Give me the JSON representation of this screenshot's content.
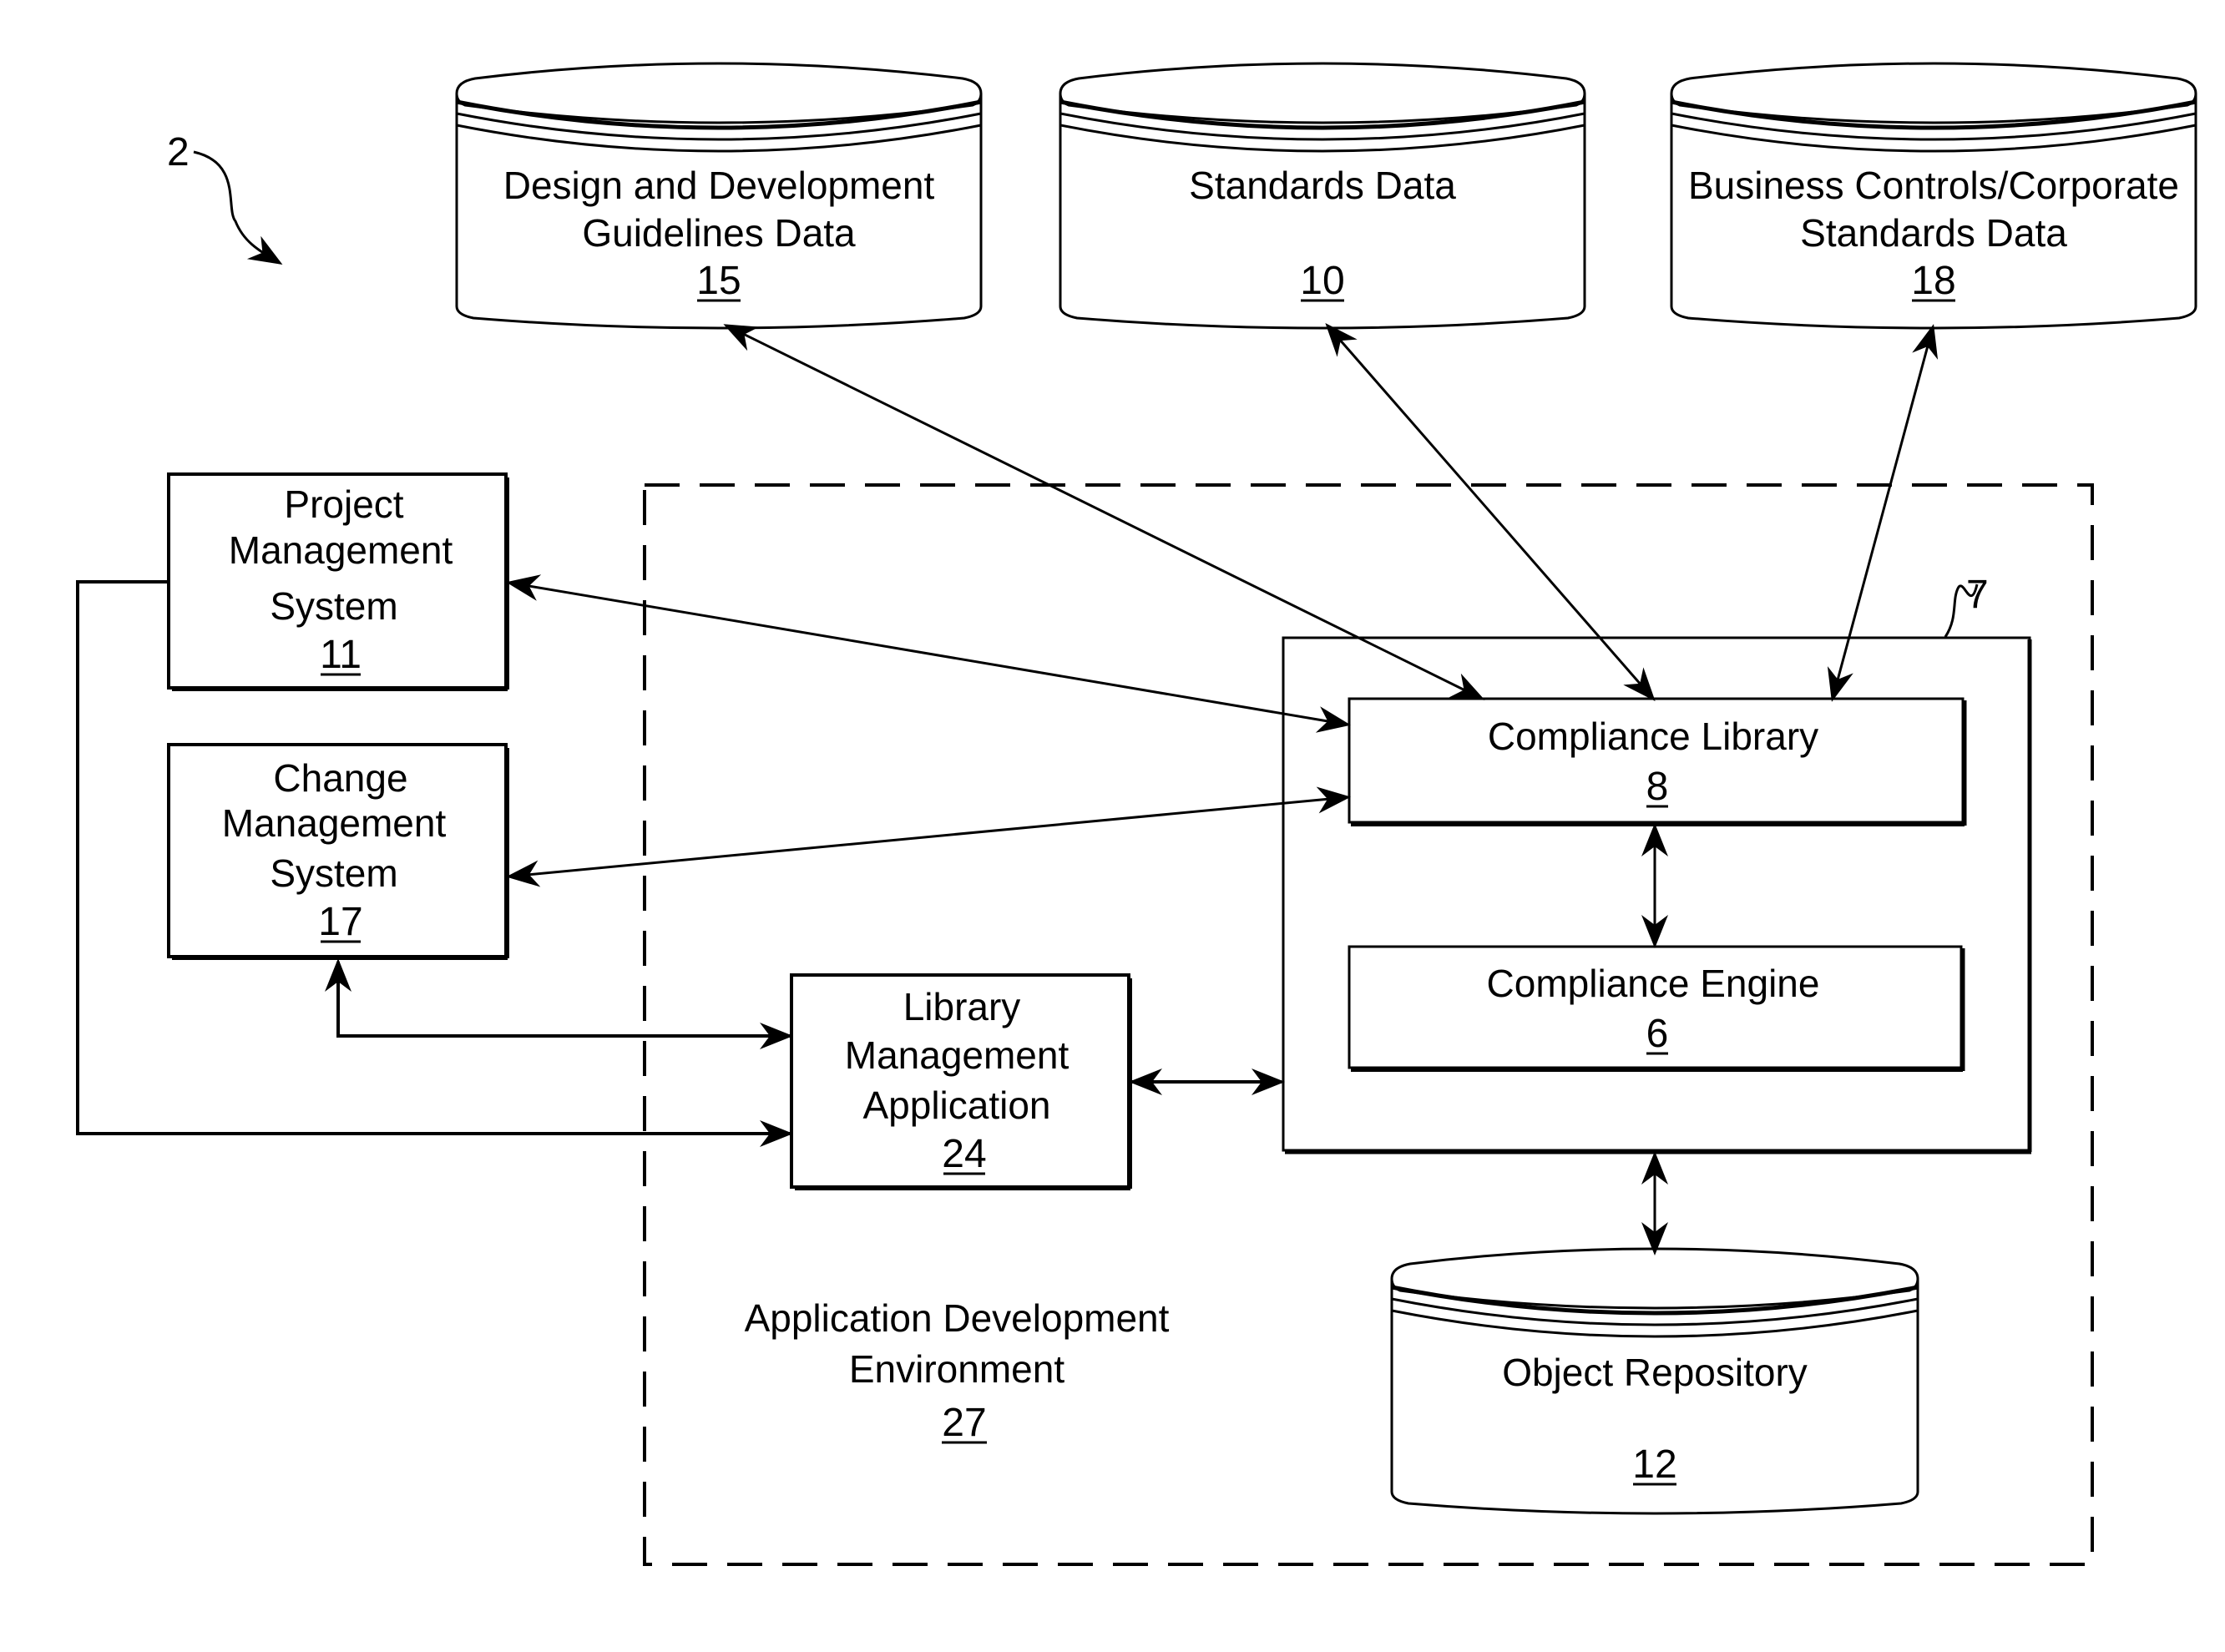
{
  "figure": {
    "reference_numeral": "2",
    "group_numeral": "7"
  },
  "databases": {
    "guidelines": {
      "lines": [
        "Design and Development",
        "Guidelines Data"
      ],
      "numeral": "15"
    },
    "standards": {
      "lines": [
        "Standards Data"
      ],
      "numeral": "10"
    },
    "business": {
      "lines": [
        "Business Controls/Corporate",
        "Standards Data"
      ],
      "numeral": "18"
    },
    "repository": {
      "lines": [
        "Object Repository"
      ],
      "numeral": "12"
    }
  },
  "systems": {
    "project": {
      "lines": [
        "Project",
        "Management",
        "System"
      ],
      "numeral": "11"
    },
    "change": {
      "lines": [
        "Change",
        "Management",
        "System"
      ],
      "numeral": "17"
    },
    "library_mgmt": {
      "lines": [
        "Library",
        "Management",
        "Application"
      ],
      "numeral": "24"
    },
    "compliance_library": {
      "lines": [
        "Compliance Library"
      ],
      "numeral": "8"
    },
    "compliance_engine": {
      "lines": [
        "Compliance Engine"
      ],
      "numeral": "6"
    }
  },
  "environment": {
    "lines": [
      "Application Development",
      "Environment"
    ],
    "numeral": "27"
  },
  "connections": [
    {
      "from": "guidelines",
      "to": "compliance_library",
      "type": "bidirectional"
    },
    {
      "from": "standards",
      "to": "compliance_library",
      "type": "bidirectional"
    },
    {
      "from": "business",
      "to": "compliance_library",
      "type": "bidirectional"
    },
    {
      "from": "project",
      "to": "compliance_library",
      "type": "bidirectional"
    },
    {
      "from": "change",
      "to": "compliance_library",
      "type": "bidirectional"
    },
    {
      "from": "compliance_library",
      "to": "compliance_engine",
      "type": "bidirectional"
    },
    {
      "from": "library_mgmt",
      "to": "compliance_group",
      "type": "bidirectional"
    },
    {
      "from": "compliance_group",
      "to": "repository",
      "type": "bidirectional"
    },
    {
      "from": "change",
      "to": "library_mgmt",
      "type": "bidirectional"
    },
    {
      "from": "project",
      "to": "library_mgmt",
      "type": "unidirectional"
    }
  ]
}
